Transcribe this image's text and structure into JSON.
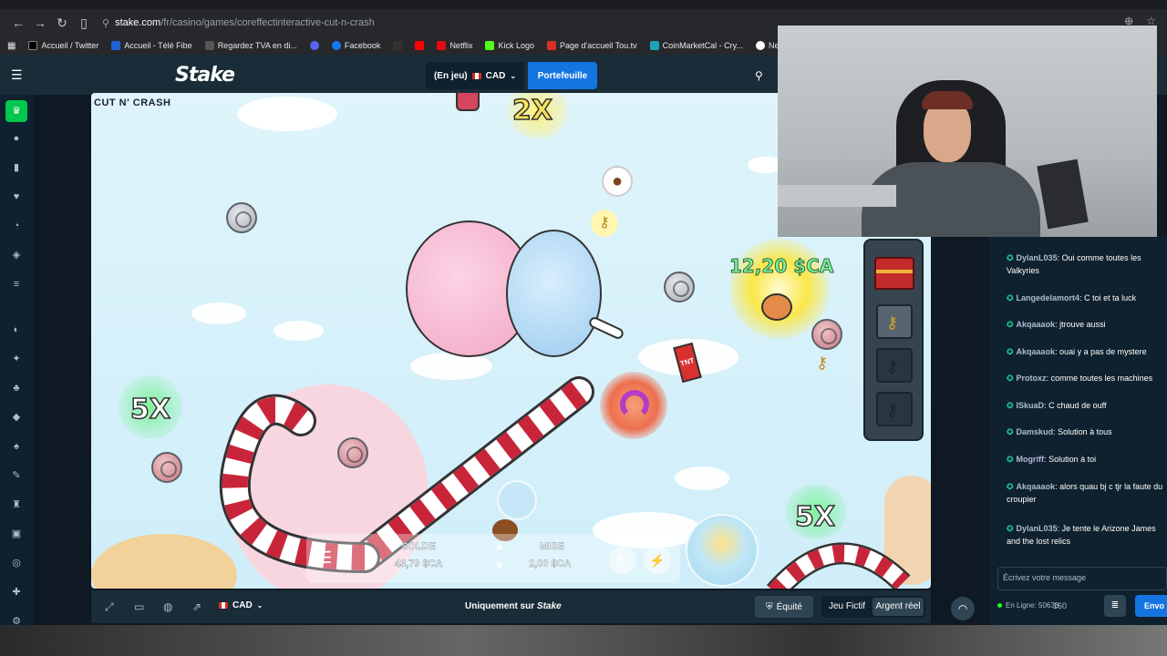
{
  "browser": {
    "url_host": "stake.com",
    "url_path": "/fr/casino/games/coreffectinteractive-cut-n-crash",
    "bookmarks": [
      {
        "label": "Accueil / Twitter",
        "color": "#000000"
      },
      {
        "label": "Accueil - Télé Fibe",
        "color": "#1e63d6"
      },
      {
        "label": "Regardez TVA en di...",
        "color": "#555555"
      },
      {
        "label": "",
        "color": "#5865f2"
      },
      {
        "label": "Facebook",
        "color": "#1877f2"
      },
      {
        "label": "",
        "color": "#333333"
      },
      {
        "label": "",
        "color": "#ff0000"
      },
      {
        "label": "Netflix",
        "color": "#e50914"
      },
      {
        "label": "Kick Logo",
        "color": "#53fc18"
      },
      {
        "label": "Page d'accueil Tou.tv",
        "color": "#d93025"
      },
      {
        "label": "CoinMarketCal - Cry...",
        "color": "#1aa4b5"
      },
      {
        "label": "New chat",
        "color": "#ffffff"
      }
    ]
  },
  "header": {
    "logo": "Stake",
    "in_play_label": "(En jeu)",
    "currency": "CAD",
    "wallet_button": "Portefeuille"
  },
  "game": {
    "title": "CUT N' CRASH",
    "multipliers": {
      "top": "2X",
      "left": "5X",
      "right": "5X"
    },
    "win_amount": "12,20 $CA",
    "solde_label": "SOLDE",
    "solde_value": "43,79 $CA",
    "mise_label": "MISE",
    "mise_value": "2,00 $CA"
  },
  "controls": {
    "currency": "CAD",
    "only_on_label": "Uniquement sur",
    "only_on_brand": "Stake",
    "fairness_button": "Équité",
    "mode_fictive": "Jeu Fictif",
    "mode_real": "Argent réel"
  },
  "chat": {
    "messages": [
      {
        "user": "DylanL035",
        "text": "Oui comme toutes les Valkyries"
      },
      {
        "user": "Langedelamort4",
        "text": "C toi et ta luck"
      },
      {
        "user": "Akqaaaok",
        "text": "jtrouve aussi"
      },
      {
        "user": "Akqaaaok",
        "text": "ouai y a pas de mystere"
      },
      {
        "user": "Protoxz",
        "text": "comme toutes les machines"
      },
      {
        "user": "ISkuaD",
        "text": "C chaud de ouff"
      },
      {
        "user": "Damskud",
        "text": "Solution à tous"
      },
      {
        "user": "Mogriff",
        "text": "Solution à toi"
      },
      {
        "user": "Akqaaaok",
        "text": "alors quau bj c tjr la faute du croupier"
      },
      {
        "user": "DylanL035",
        "text": "Je tente le Arizone James and the lost relics"
      }
    ],
    "input_placeholder": "Écrivez votre message",
    "online_label": "En Ligne: 50638",
    "char_count": "160",
    "send_button": "Envo"
  },
  "colors": {
    "header_bg": "#1a2c38",
    "sidebar_bg": "#0f212e",
    "accent_blue": "#1475e1",
    "accent_green": "#00c74d"
  }
}
